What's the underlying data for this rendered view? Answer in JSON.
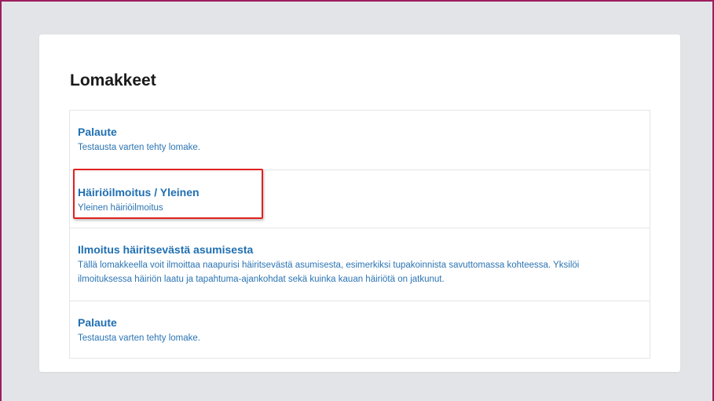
{
  "page": {
    "title": "Lomakkeet"
  },
  "forms": [
    {
      "title": "Palaute",
      "description": "Testausta varten tehty lomake."
    },
    {
      "title": "Häiriöilmoitus / Yleinen",
      "description": "Yleinen häiriöilmoitus"
    },
    {
      "title": "Ilmoitus häiritsevästä asumisesta",
      "description": "Tällä lomakkeella voit ilmoittaa naapurisi häiritsevästä asumisesta, esimerkiksi tupakoinnista savuttomassa kohteessa. Yksilöi ilmoituksessa häiriön laatu ja tapahtuma-ajankohdat sekä kuinka kauan häiriötä on jatkunut."
    },
    {
      "title": "Palaute",
      "description": "Testausta varten tehty lomake."
    }
  ],
  "colors": {
    "frame_border": "#9c1d5e",
    "background": "#e2e4e7",
    "link": "#1f6fb2",
    "highlight": "#e0201f"
  }
}
